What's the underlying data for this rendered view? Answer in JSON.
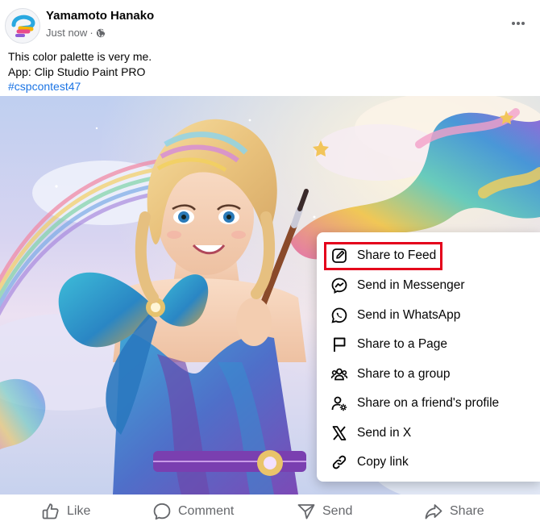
{
  "post": {
    "author": "Yamamoto Hanako",
    "timestamp": "Just now",
    "separator": "·",
    "privacy_icon": "globe-icon",
    "more_icon": "more-horizontal-icon"
  },
  "caption": {
    "line1": "This color palette is very me.",
    "line2": "App: Clip Studio Paint PRO",
    "hashtag": "#cspcontest47"
  },
  "share_menu": {
    "items": [
      {
        "label": "Share to Feed",
        "icon": "edit-icon"
      },
      {
        "label": "Send in Messenger",
        "icon": "messenger-icon"
      },
      {
        "label": "Send in WhatsApp",
        "icon": "whatsapp-icon"
      },
      {
        "label": "Share to a Page",
        "icon": "flag-icon"
      },
      {
        "label": "Share to a group",
        "icon": "group-icon"
      },
      {
        "label": "Share on a friend's profile",
        "icon": "friend-profile-icon"
      },
      {
        "label": "Send in X",
        "icon": "x-logo-icon"
      },
      {
        "label": "Copy link",
        "icon": "link-icon"
      }
    ],
    "highlighted_item": "Share to Feed",
    "highlight_color": "#e4001b"
  },
  "actions": {
    "like": "Like",
    "comment": "Comment",
    "send": "Send",
    "share": "Share"
  },
  "colors": {
    "hashtag": "#1b74e4",
    "secondary_text": "#65676b"
  }
}
